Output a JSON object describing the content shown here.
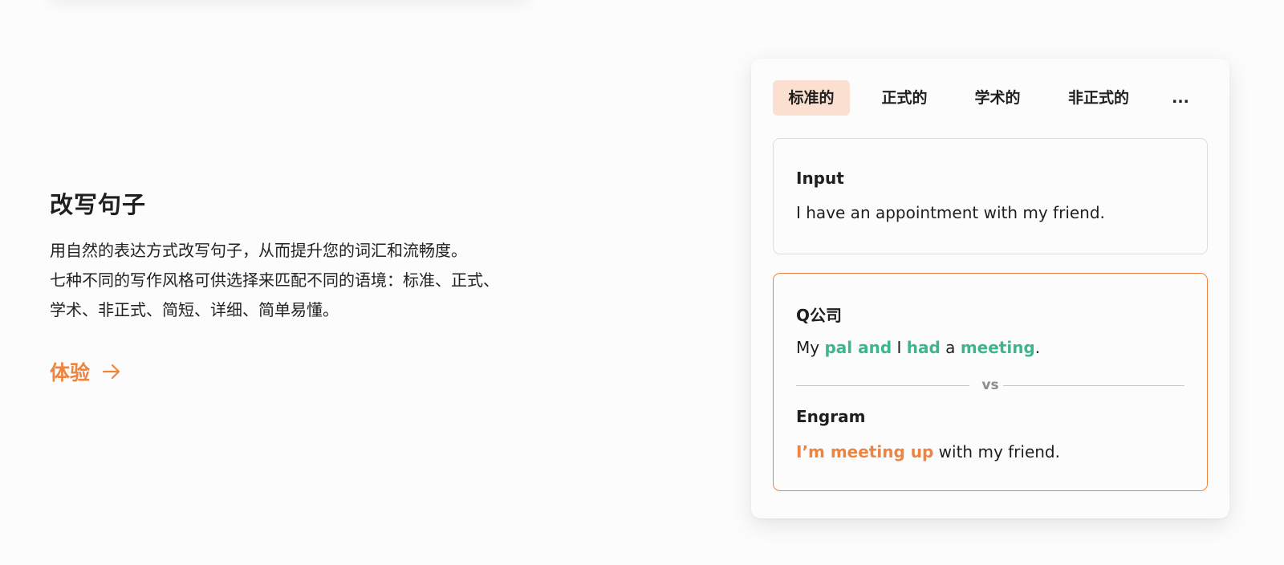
{
  "feature": {
    "title": "改写句子",
    "description_line1": "用自然的表达方式改写句子，从而提升您的词汇和流畅度。",
    "description_line2": "七种不同的写作风格可供选择来匹配不同的语境：标准、正式、",
    "description_line3": "学术、非正式、简短、详细、简单易懂。",
    "try_label": "体验",
    "accent_color": "#f0843f"
  },
  "demo": {
    "tabs": [
      {
        "label": "标准的",
        "active": true
      },
      {
        "label": "正式的",
        "active": false
      },
      {
        "label": "学术的",
        "active": false
      },
      {
        "label": "非正式的",
        "active": false
      },
      {
        "label": "...",
        "active": false
      }
    ],
    "input": {
      "label": "Input",
      "text": "I have an appointment with my friend."
    },
    "competitor": {
      "label": "Q公司",
      "parts": [
        "My ",
        "pal and",
        " I ",
        "had",
        " a ",
        "meeting",
        "."
      ]
    },
    "vs_label": "vs",
    "engram": {
      "label": "Engram",
      "parts": [
        "I’m meeting up",
        " with my friend."
      ]
    },
    "colors": {
      "active_tab_bg": "#fbdfd0",
      "competitor_highlight": "#3cb68f",
      "engram_highlight": "#f0843f"
    }
  }
}
